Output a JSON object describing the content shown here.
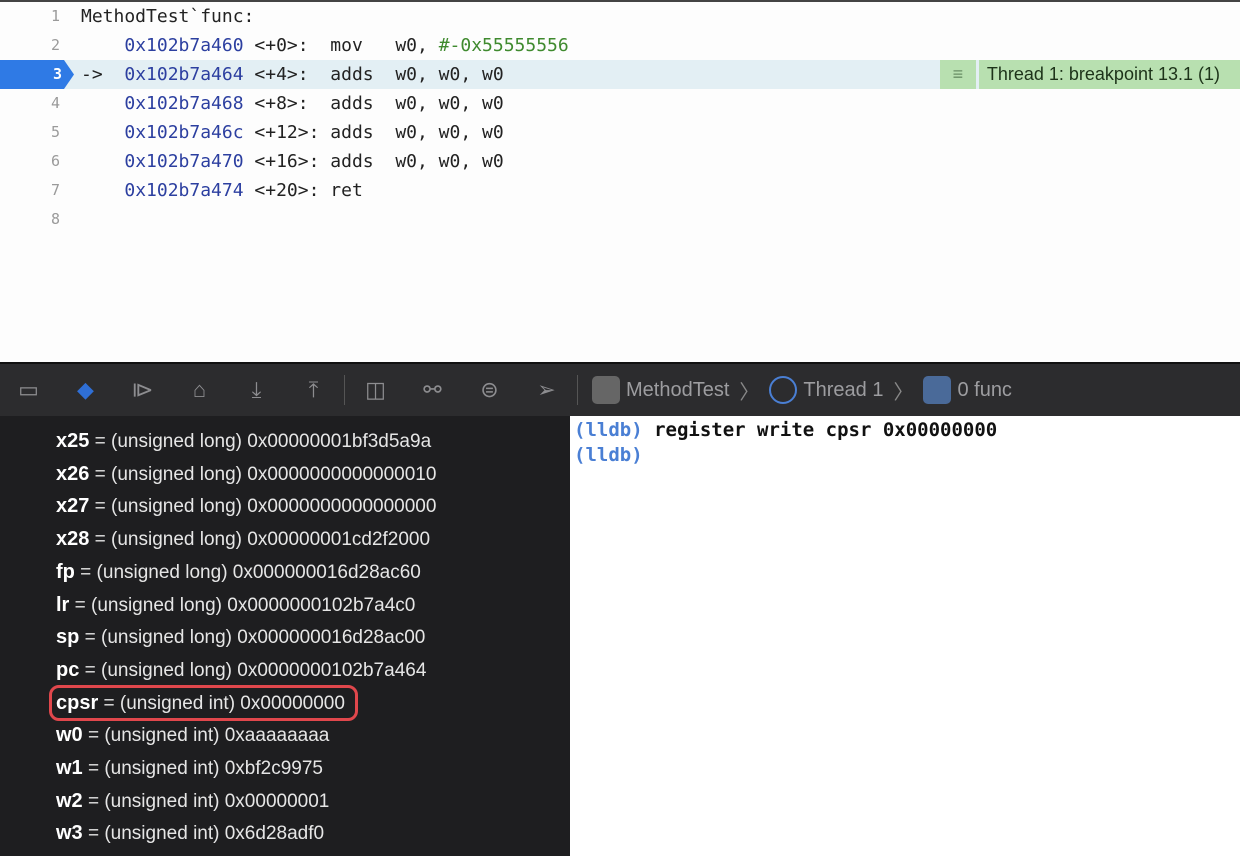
{
  "editor": {
    "lines": [
      {
        "n": "1",
        "label": "MethodTest`func:"
      },
      {
        "n": "2",
        "addr": "0x102b7a460",
        "off": "<+0>:",
        "pad": "  ",
        "op": "mov   ",
        "args": "w0, ",
        "imm": "#-0x55555556"
      },
      {
        "n": "3",
        "arrow": "->",
        "addr": "0x102b7a464",
        "off": "<+4>:",
        "pad": "  ",
        "op": "adds  ",
        "args": "w0, w0, w0",
        "current": true
      },
      {
        "n": "4",
        "addr": "0x102b7a468",
        "off": "<+8>:",
        "pad": "  ",
        "op": "adds  ",
        "args": "w0, w0, w0"
      },
      {
        "n": "5",
        "addr": "0x102b7a46c",
        "off": "<+12>:",
        "pad": " ",
        "op": "adds  ",
        "args": "w0, w0, w0"
      },
      {
        "n": "6",
        "addr": "0x102b7a470",
        "off": "<+16>:",
        "pad": " ",
        "op": "adds  ",
        "args": "w0, w0, w0"
      },
      {
        "n": "7",
        "addr": "0x102b7a474",
        "off": "<+20>:",
        "pad": " ",
        "op": "ret",
        "args": ""
      },
      {
        "n": "8"
      }
    ],
    "breakpoint_label": "Thread 1: breakpoint 13.1 (1)",
    "highlight_color": "#2f7ae5",
    "breakpoint_color": "#b8e0b0"
  },
  "toolbar": {
    "buttons": [
      "hide-debug-area-icon",
      "breakpoints-toggle-icon",
      "continue-icon",
      "step-over-icon",
      "step-into-icon",
      "step-out-icon",
      "view-hierarchy-icon",
      "memory-graph-icon",
      "environment-overrides-icon",
      "simulate-location-icon"
    ],
    "breadcrumb": [
      "MethodTest",
      "Thread 1",
      "0 func"
    ]
  },
  "variables": [
    {
      "name": "x25",
      "value": " = (unsigned long) 0x00000001bf3d5a9a"
    },
    {
      "name": "x26",
      "value": " = (unsigned long) 0x0000000000000010"
    },
    {
      "name": "x27",
      "value": " = (unsigned long) 0x0000000000000000"
    },
    {
      "name": "x28",
      "value": " = (unsigned long) 0x00000001cd2f2000"
    },
    {
      "name": "fp",
      "value": " = (unsigned long) 0x000000016d28ac60"
    },
    {
      "name": "lr",
      "value": " = (unsigned long) 0x0000000102b7a4c0"
    },
    {
      "name": "sp",
      "value": " = (unsigned long) 0x000000016d28ac00"
    },
    {
      "name": "pc",
      "value": " = (unsigned long) 0x0000000102b7a464"
    },
    {
      "name": "cpsr",
      "value": " = (unsigned int) 0x00000000",
      "highlighted": true
    },
    {
      "name": "w0",
      "value": " = (unsigned int) 0xaaaaaaaa"
    },
    {
      "name": "w1",
      "value": " = (unsigned int) 0xbf2c9975"
    },
    {
      "name": "w2",
      "value": " = (unsigned int) 0x00000001"
    },
    {
      "name": "w3",
      "value": " = (unsigned int) 0x6d28adf0"
    }
  ],
  "console": {
    "lines": [
      {
        "prompt": "(lldb)",
        "command": " register write cpsr 0x00000000"
      },
      {
        "prompt": "(lldb)",
        "command": ""
      }
    ]
  }
}
